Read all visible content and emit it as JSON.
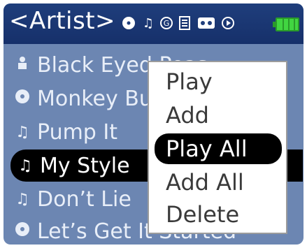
{
  "header": {
    "title": "<Artist>",
    "icons": [
      "disc-icon",
      "music-note-icon",
      "genre-icon",
      "playlist-icon",
      "tape-icon",
      "play-circle-icon"
    ],
    "battery": "battery-full-icon"
  },
  "list": {
    "items": [
      {
        "icon": "artist-icon",
        "label": "Black Eyed Peas"
      },
      {
        "icon": "album-icon",
        "label": "Monkey Business"
      },
      {
        "icon": "music-note-icon",
        "label": "Pump It"
      },
      {
        "icon": "music-note-icon",
        "label": "My Style"
      },
      {
        "icon": "music-note-icon",
        "label": "Don’t Lie"
      },
      {
        "icon": "album-icon",
        "label": "Let’s Get It Started"
      }
    ],
    "selected_index": 3
  },
  "context_menu": {
    "items": [
      "Play",
      "Add",
      "Play All",
      "Add All",
      "Delete"
    ],
    "highlighted_index": 2
  },
  "colors": {
    "header_bg": "#1f3e7c",
    "list_bg": "#6c86b2",
    "selection_bg": "#000000",
    "battery": "#41d541"
  }
}
